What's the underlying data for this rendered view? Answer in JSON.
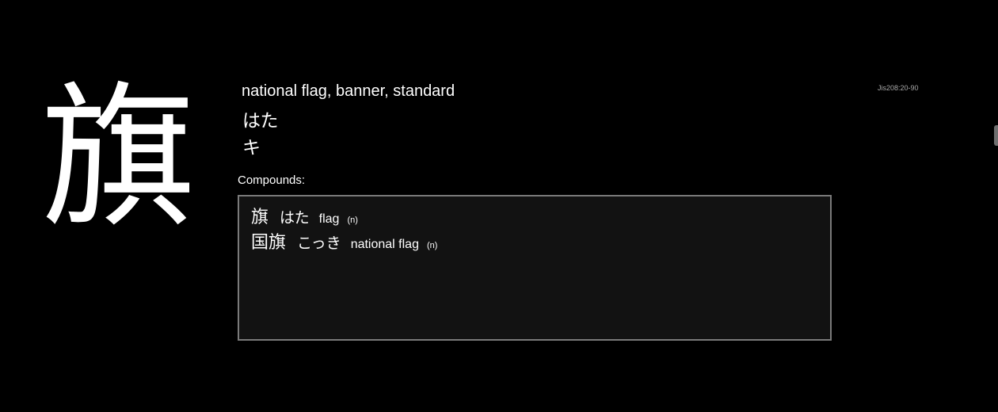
{
  "kanji": "旗",
  "meaning": "national flag, banner, standard",
  "kun_reading": "はた",
  "on_reading": "キ",
  "jis_code": "Jis208:20-90",
  "compounds_label": "Compounds:",
  "compounds": [
    {
      "word": "旗",
      "reading": "はた",
      "gloss": "flag",
      "pos": "(n)"
    },
    {
      "word": "国旗",
      "reading": "こっき",
      "gloss": "national flag",
      "pos": "(n)"
    }
  ],
  "colors": {
    "background": "#000000",
    "text": "#ffffff",
    "box_border": "#7a7a7a",
    "box_background": "#121212",
    "jis_text": "#a8a8a8"
  }
}
